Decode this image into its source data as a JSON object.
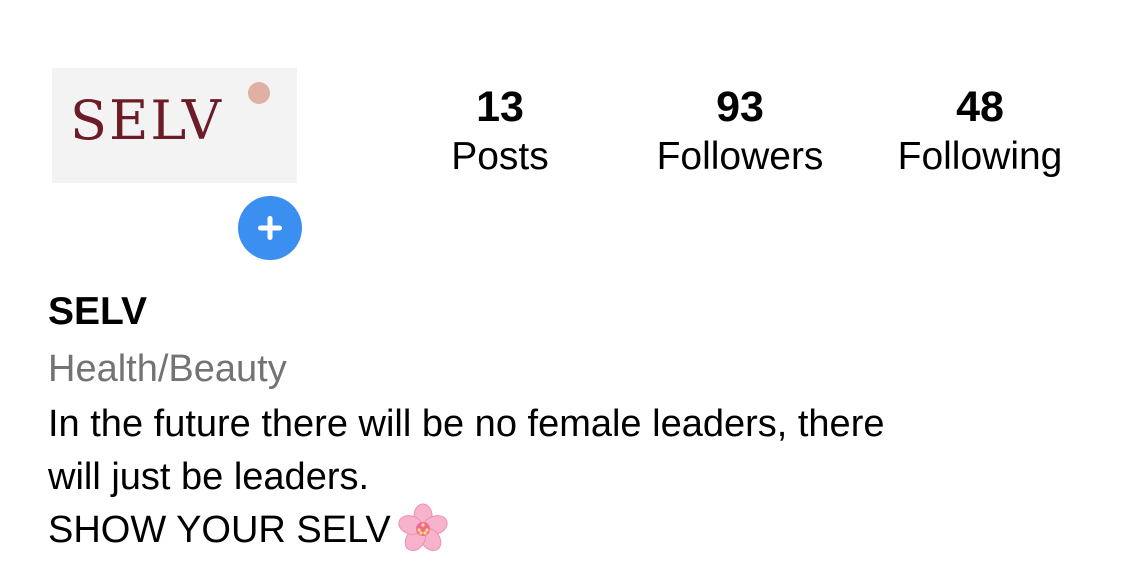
{
  "profile": {
    "avatar_text": "SELV",
    "name": "SELV",
    "category": "Health/Beauty",
    "bio_lines": [
      "In the future there will be no female leaders, there",
      "will just be leaders.",
      "SHOW YOUR SELV"
    ],
    "bio_emoji_icon": "cherry-blossom-icon"
  },
  "stats": {
    "posts": {
      "value": "13",
      "label": "Posts"
    },
    "followers": {
      "value": "93",
      "label": "Followers"
    },
    "following": {
      "value": "48",
      "label": "Following"
    }
  },
  "colors": {
    "logo": "#6b1c26",
    "logo_dot": "#e0b0a4",
    "add_button": "#3b8ff0",
    "category_text": "#737373"
  }
}
